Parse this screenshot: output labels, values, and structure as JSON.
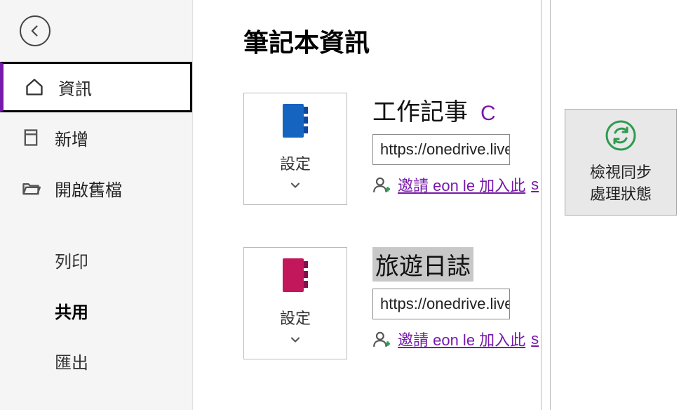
{
  "sidebar": {
    "items": [
      {
        "label": "資訊"
      },
      {
        "label": "新增"
      },
      {
        "label": "開啟舊檔"
      }
    ],
    "subitems": [
      {
        "label": "列印"
      },
      {
        "label": "共用"
      },
      {
        "label": "匯出"
      }
    ]
  },
  "page": {
    "title": "筆記本資訊"
  },
  "settings_label": "設定",
  "notebooks": [
    {
      "title": "工作記事",
      "url": "https://onedrive.live.com",
      "invite_prefix": "邀請 eon le 加入此",
      "extra_char": "C"
    },
    {
      "title": "旅遊日誌",
      "url": "https://onedrive.live.com",
      "invite_prefix": "邀請 eon le 加入此"
    }
  ],
  "sync_button": {
    "line1": "檢視同步",
    "line2": "處理狀態"
  },
  "colors": {
    "accent": "#7719aa",
    "nb1": "#1565c0",
    "nb2": "#c2185b",
    "sync": "#2e9b4f"
  }
}
